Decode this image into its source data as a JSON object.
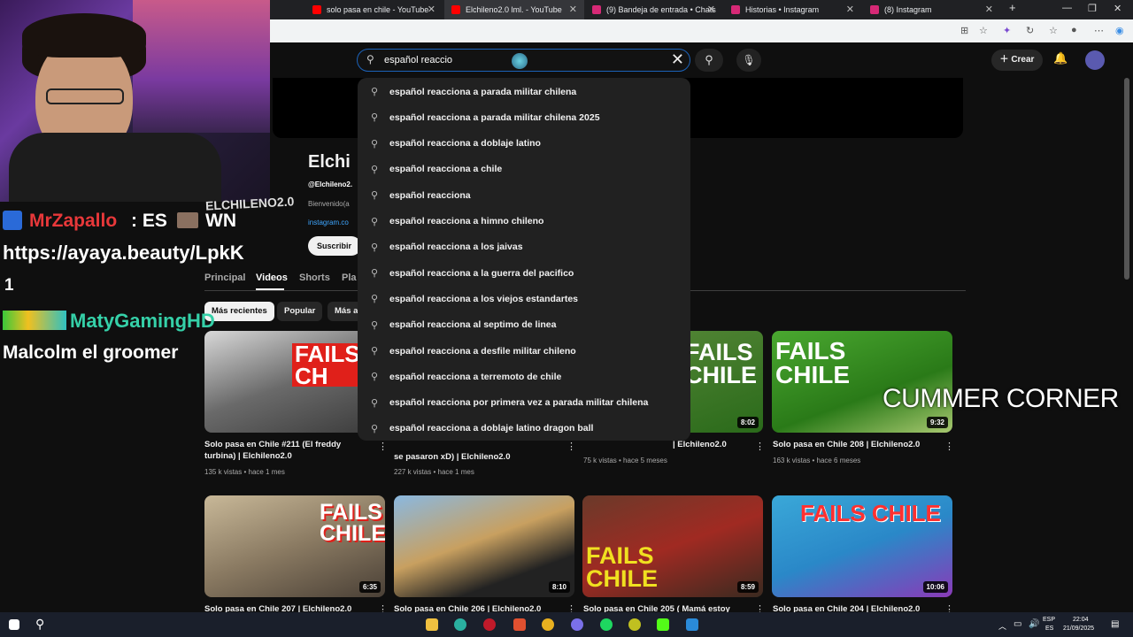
{
  "browser": {
    "tabs": [
      {
        "title": "solo pasa en chile - YouTube",
        "color": "#ff0000"
      },
      {
        "title": "Elchileno2.0 lml. - YouTube",
        "color": "#ff0000"
      },
      {
        "title": "(9) Bandeja de entrada • Chats",
        "color": "#d62976"
      },
      {
        "title": "Historias • Instagram",
        "color": "#d62976"
      },
      {
        "title": "(8) Instagram",
        "color": "#d62976"
      }
    ],
    "new_tab": "+"
  },
  "header": {
    "search_value": "español reaccio",
    "create_label": "Crear"
  },
  "suggestions": [
    "español reacciona a parada militar chilena",
    "español reacciona a parada militar chilena 2025",
    "español reacciona a doblaje latino",
    "español reacciona a chile",
    "español reacciona",
    "español reacciona a himno chileno",
    "español reacciona a los jaivas",
    "español reacciona a la guerra del pacifico",
    "español reacciona a los viejos estandartes",
    "español reacciona al septimo de linea",
    "español reacciona a desfile militar chileno",
    "español reacciona a terremoto de chile",
    "español reacciona por primera vez a parada militar chilena",
    "español reacciona a doblaje latino dragon ball"
  ],
  "channel": {
    "name": "Elchi",
    "handle": "@Elchileno2.",
    "welcome": "Bienvenido(a",
    "link": "instagram.co",
    "subscribe": "Suscribir",
    "tabs": [
      "Principal",
      "Videos",
      "Shorts",
      "Pla"
    ],
    "chips": [
      "Más recientes",
      "Popular",
      "Más a"
    ]
  },
  "videos_row1": [
    {
      "title": "Solo pasa en Chile #211 (El freddy turbina) | Elchileno2.0",
      "meta": "135 k vistas • hace 1 mes",
      "duration": "",
      "thumb_text": "FAILS CH"
    },
    {
      "title": "se pasaron xD) | Elchileno2.0",
      "meta": "227 k vistas • hace 1 mes",
      "duration": "",
      "thumb_text": ""
    },
    {
      "title": "| Elchileno2.0",
      "meta": "75 k vistas • hace 5 meses",
      "duration": "8:02",
      "thumb_text": "FAILS CHILE"
    },
    {
      "title": "Solo pasa en Chile 208 | Elchileno2.0",
      "meta": "163 k vistas • hace 6 meses",
      "duration": "9:32",
      "thumb_text": "FAILS CHILE"
    }
  ],
  "videos_row2": [
    {
      "title": "Solo pasa en Chile 207 | Elchileno2.0",
      "duration": "6:35",
      "thumb_text": "FAILS CHILE"
    },
    {
      "title": "Solo pasa en Chile 206 | Elchileno2.0",
      "duration": "8:10",
      "thumb_text": ""
    },
    {
      "title": "Solo pasa en Chile 205 ( Mamá estoy",
      "duration": "8:59",
      "thumb_text": "FAILS CHILE"
    },
    {
      "title": "Solo pasa en Chile 204 | Elchileno2.0",
      "duration": "10:06",
      "thumb_text": "FAILS CHILE"
    }
  ],
  "stream_overlay": {
    "chat1_user": "MrZapallo",
    "chat1_msg": ": ES",
    "chat1_tail": "WN",
    "chat1_url": "https://ayaya.beauty/LpkK",
    "chat1_count": "1",
    "chat2_user": "MatyGamingHD",
    "chat2_msg": "Malcolm el groomer",
    "corner_text": "CUMMER CORNER",
    "cam_badge": "ELCHILENO2.0"
  },
  "taskbar": {
    "lang1": "ESP",
    "lang2": "ES",
    "time": "22:04",
    "date": "21/09/2025"
  }
}
